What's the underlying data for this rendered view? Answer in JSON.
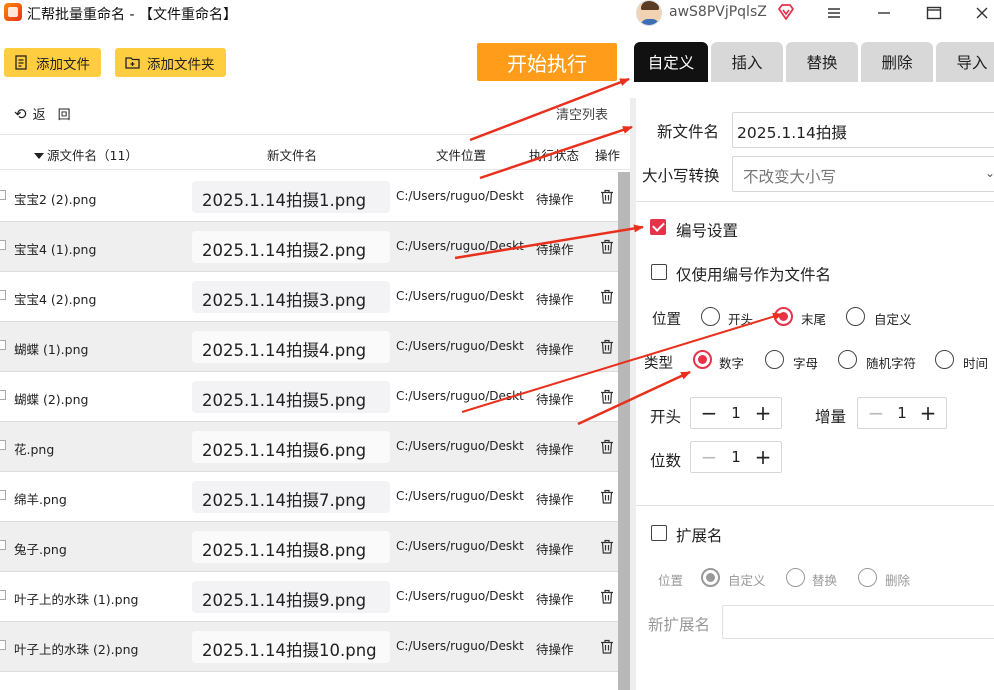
{
  "window": {
    "title": "汇帮批量重命名 - 【文件重命名】",
    "username": "awS8PVjPqlsZ"
  },
  "toolbar": {
    "add_file": "添加文件",
    "add_folder": "添加文件夹",
    "start": "开始执行",
    "back": "返回",
    "clear_list": "清空列表"
  },
  "table": {
    "headers": {
      "source": "源文件名（11）",
      "new_name": "新文件名",
      "location": "文件位置",
      "status": "执行状态",
      "action": "操作"
    },
    "rows": [
      {
        "source": "宝宝2 (2).png",
        "new_name": "2025.1.14拍摄1.png",
        "location": "C:/Users/ruguo/Desktop",
        "status": "待操作"
      },
      {
        "source": "宝宝4 (1).png",
        "new_name": "2025.1.14拍摄2.png",
        "location": "C:/Users/ruguo/Desktop",
        "status": "待操作"
      },
      {
        "source": "宝宝4 (2).png",
        "new_name": "2025.1.14拍摄3.png",
        "location": "C:/Users/ruguo/Desktop",
        "status": "待操作"
      },
      {
        "source": "蝴蝶 (1).png",
        "new_name": "2025.1.14拍摄4.png",
        "location": "C:/Users/ruguo/Desktop",
        "status": "待操作"
      },
      {
        "source": "蝴蝶 (2).png",
        "new_name": "2025.1.14拍摄5.png",
        "location": "C:/Users/ruguo/Desktop",
        "status": "待操作"
      },
      {
        "source": "花.png",
        "new_name": "2025.1.14拍摄6.png",
        "location": "C:/Users/ruguo/Desktop",
        "status": "待操作"
      },
      {
        "source": "绵羊.png",
        "new_name": "2025.1.14拍摄7.png",
        "location": "C:/Users/ruguo/Desktop",
        "status": "待操作"
      },
      {
        "source": "兔子.png",
        "new_name": "2025.1.14拍摄8.png",
        "location": "C:/Users/ruguo/Desktop",
        "status": "待操作"
      },
      {
        "source": "叶子上的水珠 (1).png",
        "new_name": "2025.1.14拍摄9.png",
        "location": "C:/Users/ruguo/Desktop",
        "status": "待操作"
      },
      {
        "source": "叶子上的水珠 (2).png",
        "new_name": "2025.1.14拍摄10.png",
        "location": "C:/Users/ruguo/Desktop",
        "status": "待操作"
      }
    ]
  },
  "tabs": [
    "自定义",
    "插入",
    "替换",
    "删除",
    "导入"
  ],
  "settings": {
    "new_filename_label": "新文件名",
    "new_filename_value": "2025.1.14拍摄",
    "case_label": "大小写转换",
    "case_value": "不改变大小写",
    "numbering_label": "编号设置",
    "numbering_checked": true,
    "only_number_label": "仅使用编号作为文件名",
    "only_number_checked": false,
    "position_label": "位置",
    "position_options": [
      "开头",
      "末尾",
      "自定义"
    ],
    "position_selected": "末尾",
    "type_label": "类型",
    "type_options": [
      "数字",
      "字母",
      "随机字符",
      "时间"
    ],
    "type_selected": "数字",
    "start_label": "开头",
    "start_value": "1",
    "increment_label": "增量",
    "increment_value": "1",
    "digits_label": "位数",
    "digits_value": "1",
    "extension_label": "扩展名",
    "extension_checked": false,
    "ext_position_label": "位置",
    "ext_position_options": [
      "自定义",
      "替换",
      "删除"
    ],
    "ext_position_selected": "自定义",
    "new_ext_label": "新扩展名",
    "new_ext_value": ""
  },
  "colors": {
    "accent_red": "#e8324a",
    "toolbar_yellow": "#ffcd3f",
    "start_orange": "#ff9d1a",
    "annotation_arrow": "#e8301c"
  }
}
